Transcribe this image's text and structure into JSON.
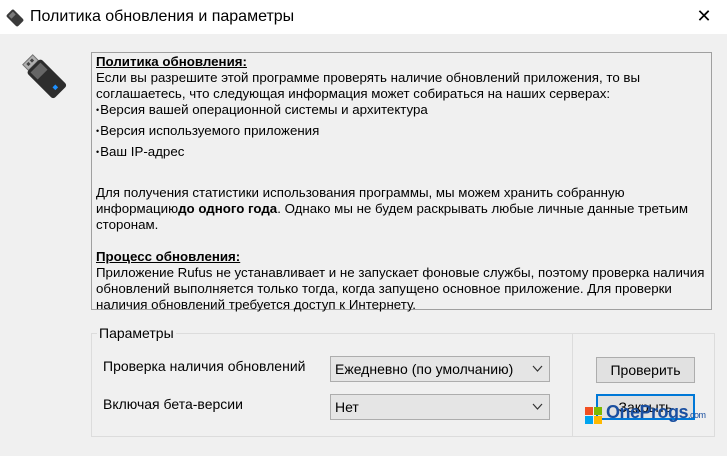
{
  "window": {
    "title": "Политика обновления и параметры",
    "close_glyph": "✕"
  },
  "policy": {
    "heading1": "Политика обновления:",
    "intro": "Если вы разрешите этой программе проверять наличие обновлений приложения, то вы соглашаетесь, что следующая информация может собираться на наших серверах:",
    "bullets": [
      "Версия вашей операционной системы и архитектура",
      "Версия используемого приложения",
      "Ваш IP-адрес"
    ],
    "stats_part1": "Для получения статистики использования программы, мы можем хранить собранную информацию",
    "stats_bold": "до одного года",
    "stats_part2": ". Однако мы не будем раскрывать любые личные данные третьим сторонам.",
    "heading2": "Процесс обновления:",
    "process": "Приложение Rufus не устанавливает и не запускает фоновые службы, поэтому проверка наличия обновлений выполняется только тогда, когда запущено основное приложение. Для проверки наличия обновлений требуется доступ к Интернету."
  },
  "settings": {
    "legend": "Параметры",
    "check_label": "Проверка наличия обновлений",
    "check_value": "Ежедневно (по умолчанию)",
    "beta_label": "Включая бета-версии",
    "beta_value": "Нет"
  },
  "buttons": {
    "check_now": "Проверить",
    "close": "Закрыть"
  },
  "watermark": {
    "text": "OneProgs",
    "suffix": ".com"
  },
  "icons": {
    "title_icon": "usb-drive-icon",
    "dialog_icon": "usb-drive-icon",
    "dropdown_chevron": "chevron-down-icon",
    "watermark_logo": "windows-logo-icon"
  }
}
